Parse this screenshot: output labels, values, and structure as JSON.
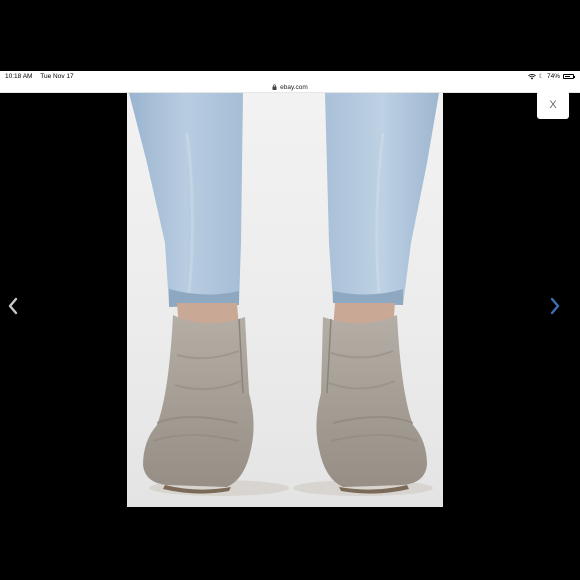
{
  "status_bar": {
    "time": "10:18 AM",
    "date": "Tue Nov 17",
    "battery": "74%",
    "battery_level": 0.74
  },
  "browser": {
    "url": "ebay.com"
  },
  "viewer": {
    "close_label": "X",
    "prev_icon": "chevron-left-icon",
    "next_icon": "chevron-right-icon",
    "arrow_left_color": "#c8c8c8",
    "arrow_right_color": "#3d6fb3"
  }
}
